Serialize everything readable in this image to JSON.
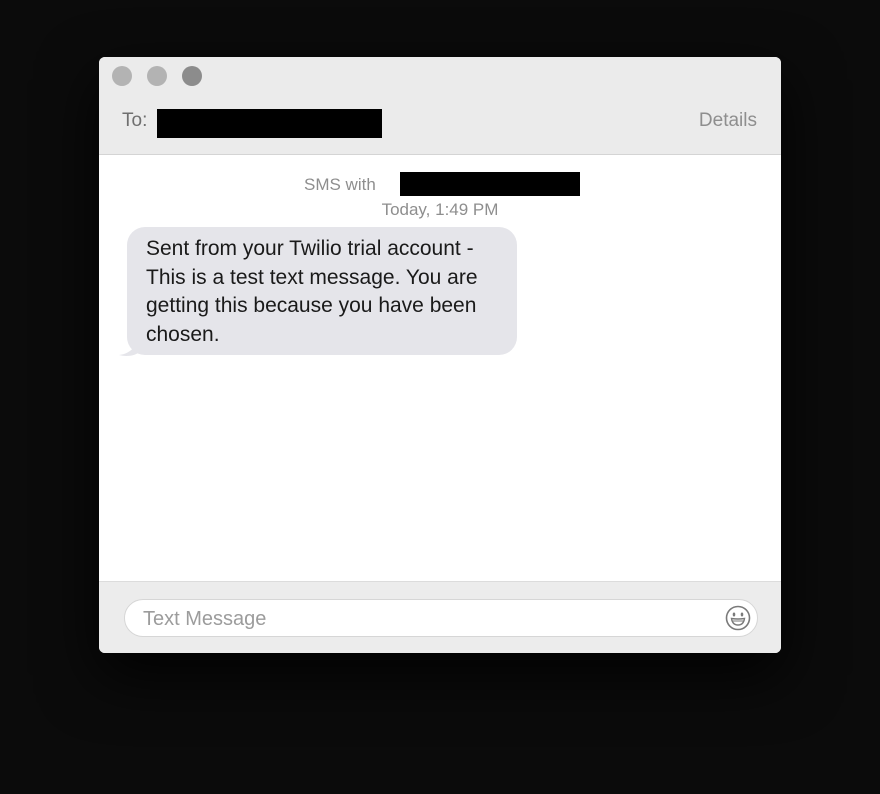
{
  "header": {
    "to_label": "To:",
    "details_label": "Details"
  },
  "conversation": {
    "sms_with_label": "SMS with",
    "timestamp": "Today, 1:49 PM",
    "messages": [
      {
        "direction": "incoming",
        "text": "Sent from your Twilio trial account - This is a test text message. You are getting this because you have been chosen."
      }
    ]
  },
  "composer": {
    "placeholder": "Text Message",
    "value": "",
    "emoji_icon": "emoji-icon"
  },
  "colors": {
    "incoming_bubble": "#e5e5ea",
    "titlebar": "#ebebeb",
    "secondary_text": "#8e8e8e"
  }
}
